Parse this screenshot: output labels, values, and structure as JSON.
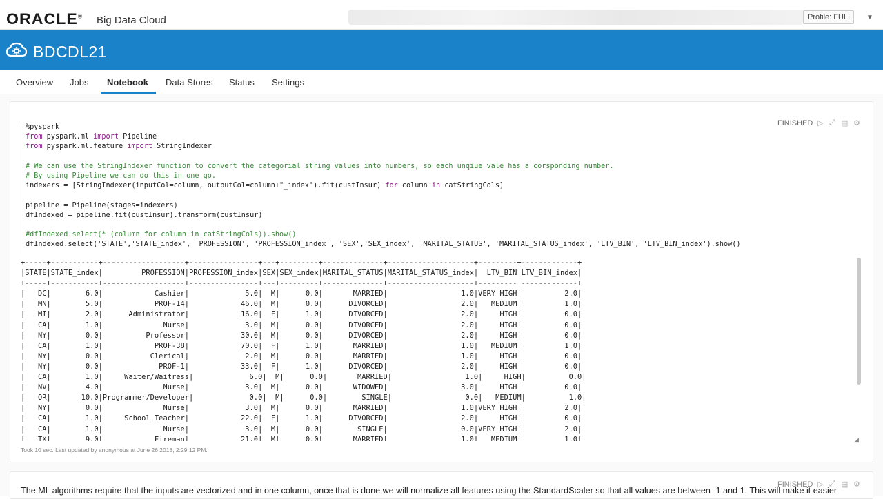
{
  "header": {
    "brand": "ORACLE",
    "product": "Big Data Cloud",
    "profile_label": "Profile: FULL"
  },
  "cluster": {
    "name": "BDCDL21"
  },
  "tabs": [
    {
      "label": "Overview"
    },
    {
      "label": "Jobs"
    },
    {
      "label": "Notebook"
    },
    {
      "label": "Data Stores"
    },
    {
      "label": "Status"
    },
    {
      "label": "Settings"
    }
  ],
  "active_tab": "Notebook",
  "paragraph1": {
    "status": "FINISHED",
    "code_lines": [
      {
        "cls": "",
        "text": "%pyspark"
      },
      {
        "cls": "imp",
        "a": "from",
        "b": " pyspark.ml ",
        "c": "import",
        "d": " Pipeline"
      },
      {
        "cls": "imp",
        "a": "from",
        "b": " pyspark.ml.feature ",
        "c": "import",
        "d": " StringIndexer"
      },
      {
        "cls": "",
        "text": ""
      },
      {
        "cls": "cm",
        "text": "# We can use the StringIndexer function to convert the categorial string values into numbers, so each unqiue vale has a corsponding number."
      },
      {
        "cls": "cm",
        "text": "# By using Pipeline we can do this in one go."
      },
      {
        "cls": "idx",
        "a": "indexers = [StringIndexer(inputCol=column, outputCol=column+\"_index\").fit(custInsur) ",
        "b": "for",
        "c": " column ",
        "d": "in",
        "e": " catStringCols]"
      },
      {
        "cls": "",
        "text": ""
      },
      {
        "cls": "",
        "text": "pipeline = Pipeline(stages=indexers)"
      },
      {
        "cls": "",
        "text": "dfIndexed = pipeline.fit(custInsur).transform(custInsur)"
      },
      {
        "cls": "",
        "text": ""
      },
      {
        "cls": "cm",
        "text": "#dfIndexed.select(* (column for column in catStringCols)).show()"
      },
      {
        "cls": "",
        "text": "dfIndexed.select('STATE','STATE_index', 'PROFESSION', 'PROFESSION_index', 'SEX','SEX_index', 'MARITAL_STATUS', 'MARITAL_STATUS_index', 'LTV_BIN', 'LTV_BIN_index').show()"
      }
    ],
    "output": "+-----+-----------+-------------------+----------------+---+---------+--------------+--------------------+---------+-------------+\n|STATE|STATE_index|         PROFESSION|PROFESSION_index|SEX|SEX_index|MARITAL_STATUS|MARITAL_STATUS_index|  LTV_BIN|LTV_BIN_index|\n+-----+-----------+-------------------+----------------+---+---------+--------------+--------------------+---------+-------------+\n|   DC|        6.0|            Cashier|             5.0|  M|      0.0|       MARRIED|                 1.0|VERY HIGH|          2.0|\n|   MN|        5.0|            PROF-14|            46.0|  M|      0.0|      DIVORCED|                 2.0|   MEDIUM|          1.0|\n|   MI|        2.0|      Administrator|            16.0|  F|      1.0|      DIVORCED|                 2.0|     HIGH|          0.0|\n|   CA|        1.0|              Nurse|             3.0|  M|      0.0|      DIVORCED|                 2.0|     HIGH|          0.0|\n|   NY|        0.0|          Professor|            30.0|  M|      0.0|      DIVORCED|                 2.0|     HIGH|          0.0|\n|   CA|        1.0|            PROF-38|            70.0|  F|      1.0|       MARRIED|                 1.0|   MEDIUM|          1.0|\n|   NY|        0.0|           Clerical|             2.0|  M|      0.0|       MARRIED|                 1.0|     HIGH|          0.0|\n|   NY|        0.0|             PROF-1|            33.0|  F|      1.0|      DIVORCED|                 2.0|     HIGH|          0.0|\n|   CA|        1.0|     Waiter/Waitress|             6.0|  M|      0.0|       MARRIED|                 1.0|     HIGH|          0.0|\n|   NV|        4.0|              Nurse|             3.0|  M|      0.0|       WIDOWED|                 3.0|     HIGH|          0.0|\n|   OR|       10.0|Programmer/Developer|             0.0|  M|      0.0|        SINGLE|                 0.0|   MEDIUM|          1.0|\n|   NY|        0.0|              Nurse|             3.0|  M|      0.0|       MARRIED|                 1.0|VERY HIGH|          2.0|\n|   CA|        1.0|     School Teacher|            22.0|  F|      1.0|      DIVORCED|                 2.0|     HIGH|          0.0|\n|   CA|        1.0|              Nurse|             3.0|  M|      0.0|        SINGLE|                 0.0|VERY HIGH|          2.0|\n|   TX|        9.0|            Fireman|            21.0|  M|      0.0|       MARRIED|                 1.0|   MEDIUM|          1.0|",
    "footer": "Took 10 sec. Last updated by anonymous at June 26 2018, 2:29:12 PM."
  },
  "paragraph2": {
    "status": "FINISHED",
    "text": "The ML algorithms require that the inputs are vectorized and in one column, once that is done we will normalize all features using the StandardScaler so that all values are between -1 and 1. This will make it easier"
  },
  "colors": {
    "brand_blue": "#1a82c8"
  }
}
